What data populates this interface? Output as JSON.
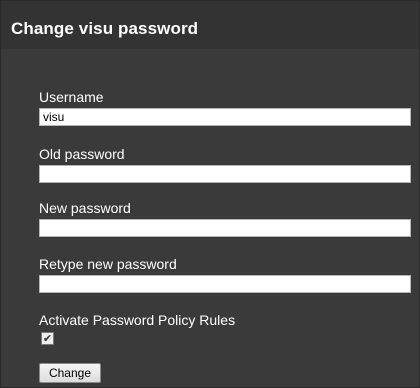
{
  "dialog": {
    "title": "Change visu password"
  },
  "form": {
    "username_label": "Username",
    "username_value": "visu",
    "old_password_label": "Old password",
    "old_password_value": "",
    "new_password_label": "New password",
    "new_password_value": "",
    "retype_password_label": "Retype new password",
    "retype_password_value": "",
    "policy_label": "Activate Password Policy Rules",
    "policy_checked_glyph": "✔",
    "change_button_label": "Change"
  },
  "colors": {
    "background": "#3a3a3a",
    "title_bar": "#333333",
    "text": "#ffffff",
    "field_bg": "#ffffff"
  }
}
